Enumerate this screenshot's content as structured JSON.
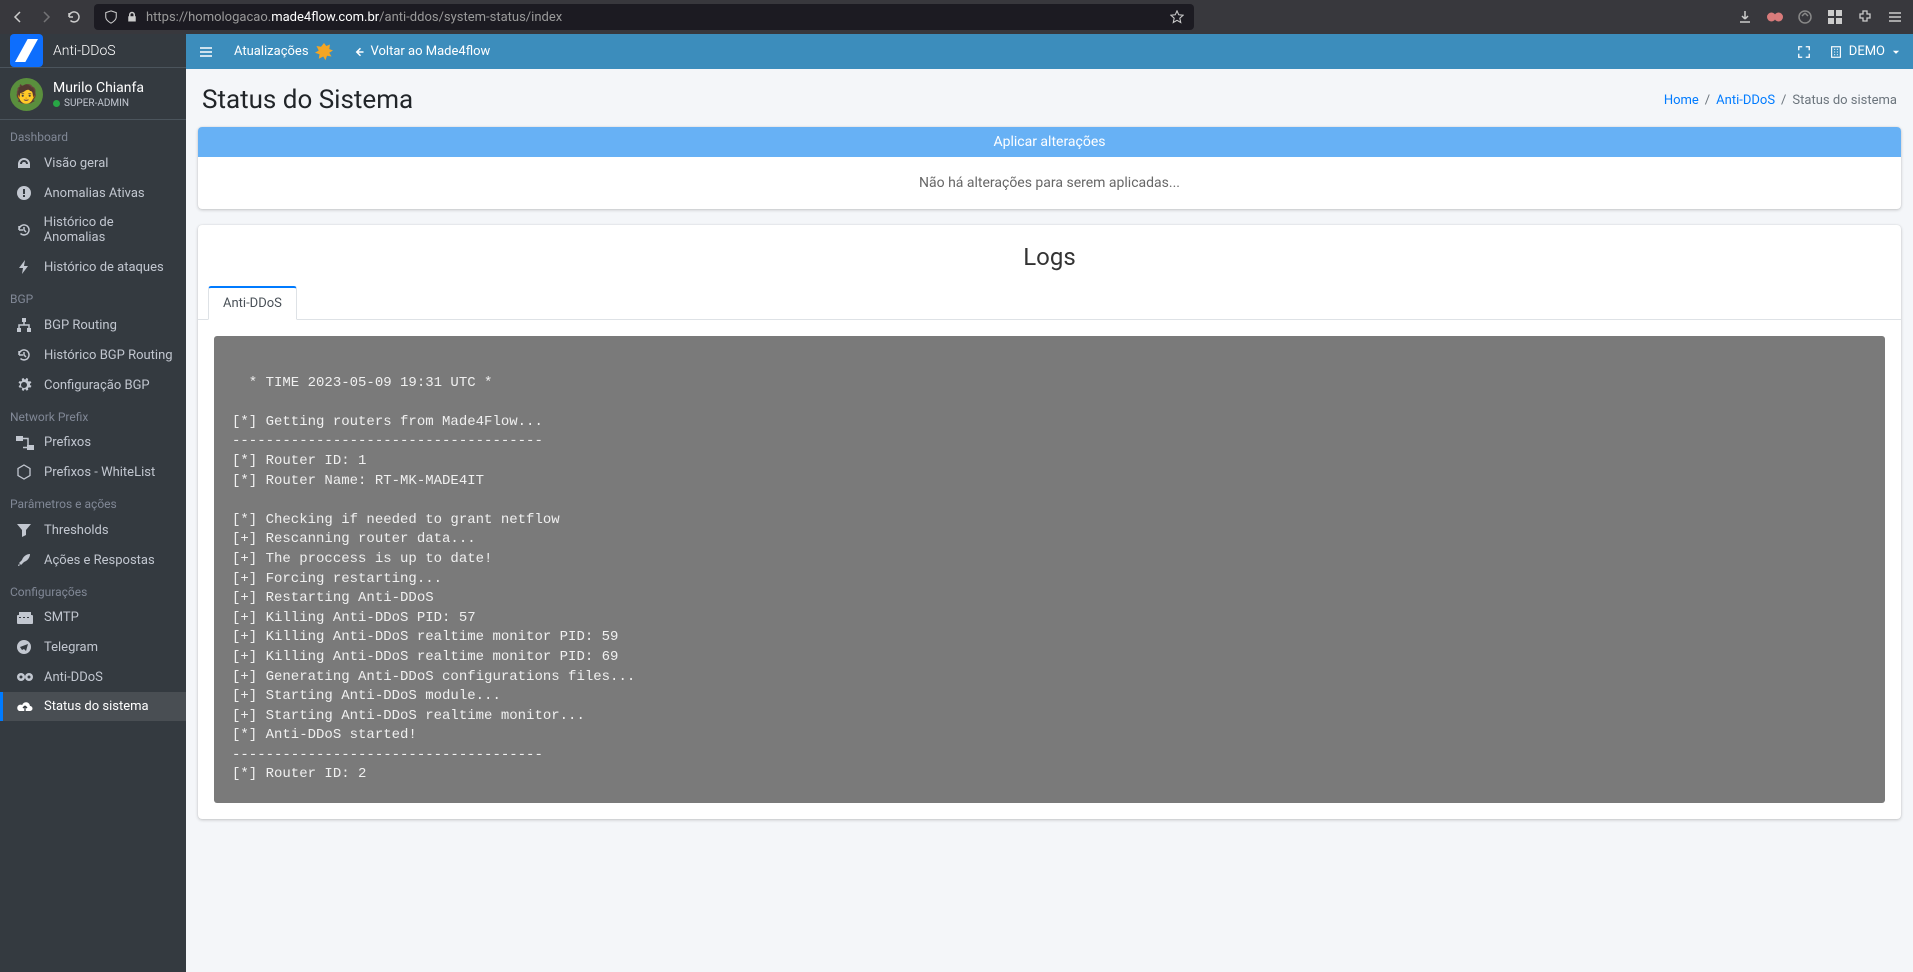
{
  "browser": {
    "url_prefix": "https://homologacao.",
    "url_domain": "made4flow.com.br",
    "url_path": "/anti-ddos/system-status/index"
  },
  "brand": {
    "text": "Anti-DDoS"
  },
  "user": {
    "name": "Murilo Chianfa",
    "role": "SUPER-ADMIN"
  },
  "sidebar": {
    "sections": [
      {
        "title": "Dashboard",
        "items": [
          {
            "icon": "dashboard",
            "label": "Visão geral"
          },
          {
            "icon": "alert",
            "label": "Anomalias Ativas"
          },
          {
            "icon": "history",
            "label": "Histórico de Anomalias"
          },
          {
            "icon": "bolt",
            "label": "Histórico de ataques"
          }
        ]
      },
      {
        "title": "BGP",
        "items": [
          {
            "icon": "routing",
            "label": "BGP Routing"
          },
          {
            "icon": "history",
            "label": "Histórico BGP Routing"
          },
          {
            "icon": "gear",
            "label": "Configuração BGP"
          }
        ]
      },
      {
        "title": "Network Prefix",
        "items": [
          {
            "icon": "prefix",
            "label": "Prefixos"
          },
          {
            "icon": "hex",
            "label": "Prefixos - WhiteList"
          }
        ]
      },
      {
        "title": "Parâmetros e ações",
        "items": [
          {
            "icon": "filter",
            "label": "Thresholds"
          },
          {
            "icon": "rocket",
            "label": "Ações e Respostas"
          }
        ]
      },
      {
        "title": "Configurações",
        "items": [
          {
            "icon": "smtp",
            "label": "SMTP"
          },
          {
            "icon": "telegram",
            "label": "Telegram"
          },
          {
            "icon": "gears",
            "label": "Anti-DDoS"
          },
          {
            "icon": "cloud",
            "label": "Status do sistema",
            "active": true
          }
        ]
      }
    ]
  },
  "topbar": {
    "updates": "Atualizações",
    "back": "Voltar ao Made4flow",
    "demo": "DEMO"
  },
  "page": {
    "title": "Status do Sistema",
    "breadcrumb": {
      "home": "Home",
      "section": "Anti-DDoS",
      "current": "Status do sistema"
    }
  },
  "apply_card": {
    "header": "Aplicar alterações",
    "body": "Não há alterações para serem aplicadas..."
  },
  "logs": {
    "title": "Logs",
    "tabs": [
      {
        "label": "Anti-DDoS",
        "active": true
      }
    ],
    "content": "\n  * TIME 2023-05-09 19:31 UTC *\n\n[*] Getting routers from Made4Flow...\n-------------------------------------\n[*] Router ID: 1\n[*] Router Name: RT-MK-MADE4IT\n\n[*] Checking if needed to grant netflow\n[+] Rescanning router data...\n[+] The proccess is up to date!\n[+] Forcing restarting...\n[+] Restarting Anti-DDoS\n[+] Killing Anti-DDoS PID: 57\n[+] Killing Anti-DDoS realtime monitor PID: 59\n[+] Killing Anti-DDoS realtime monitor PID: 69\n[+] Generating Anti-DDoS configurations files...\n[+] Starting Anti-DDoS module...\n[+] Starting Anti-DDoS realtime monitor...\n[*] Anti-DDoS started!\n-------------------------------------\n[*] Router ID: 2\n"
  }
}
